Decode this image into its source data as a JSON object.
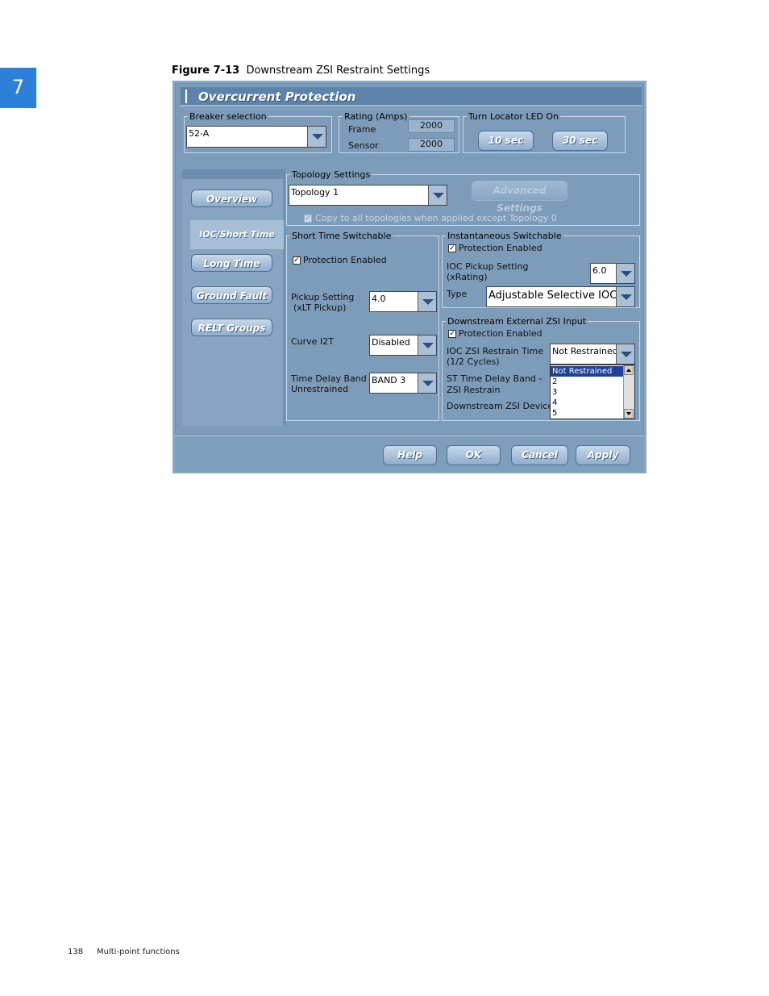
{
  "chapter": "7",
  "figure": {
    "number": "Figure 7-13",
    "title": "Downstream ZSI Restraint Settings"
  },
  "footer": {
    "page": "138",
    "section": "Multi-point functions"
  },
  "window": {
    "title": "Overcurrent Protection",
    "breaker": {
      "legend": "Breaker selection",
      "value": "52-A"
    },
    "rating": {
      "legend": "Rating (Amps)",
      "frame_label": "Frame",
      "frame_value": "2000",
      "sensor_label": "Sensor",
      "sensor_value": "2000"
    },
    "locator": {
      "legend": "Turn Locator LED On",
      "btn10": "10 sec",
      "btn30": "30 sec"
    },
    "nav": {
      "items": [
        "Overview",
        "IOC/Short Time",
        "Long Time",
        "Ground Fault",
        "RELT Groups"
      ],
      "selected": "IOC/Short Time"
    },
    "topology": {
      "legend": "Topology Settings",
      "value": "Topology 1",
      "advanced": "Advanced Settings",
      "copy_label": "Copy to all topologies when applied except Topology 0"
    },
    "short_time": {
      "legend": "Short Time Switchable",
      "protection": "Protection Enabled",
      "pickup_label_1": "Pickup Setting",
      "pickup_label_2": "(xLT Pickup)",
      "pickup_value": "4.0",
      "curve_label": "Curve I2T",
      "curve_value": "Disabled",
      "delay_label_1": "Time Delay Band -",
      "delay_label_2": "Unrestrained",
      "delay_value": "BAND 3"
    },
    "instantaneous": {
      "legend": "Instantaneous Switchable",
      "protection": "Protection Enabled",
      "ioc_label_1": "IOC Pickup Setting",
      "ioc_label_2": "(xRating)",
      "ioc_value": "6.0",
      "type_label": "Type",
      "type_value": "Adjustable Selective IOC"
    },
    "zsi": {
      "legend": "Downstream External ZSI Input",
      "protection": "Protection Enabled",
      "restrain_label_1": "IOC ZSI Restrain Time",
      "restrain_label_2": "(1/2 Cycles)",
      "restrain_value": "Not Restrained",
      "st_label_1": "ST Time Delay Band -",
      "st_label_2": "ZSI Restrain",
      "device_label": "Downstream ZSI Device",
      "options": [
        "Not Restrained",
        "2",
        "3",
        "4",
        "5"
      ]
    },
    "buttons": {
      "help": "Help",
      "ok": "OK",
      "cancel": "Cancel",
      "apply": "Apply"
    }
  }
}
